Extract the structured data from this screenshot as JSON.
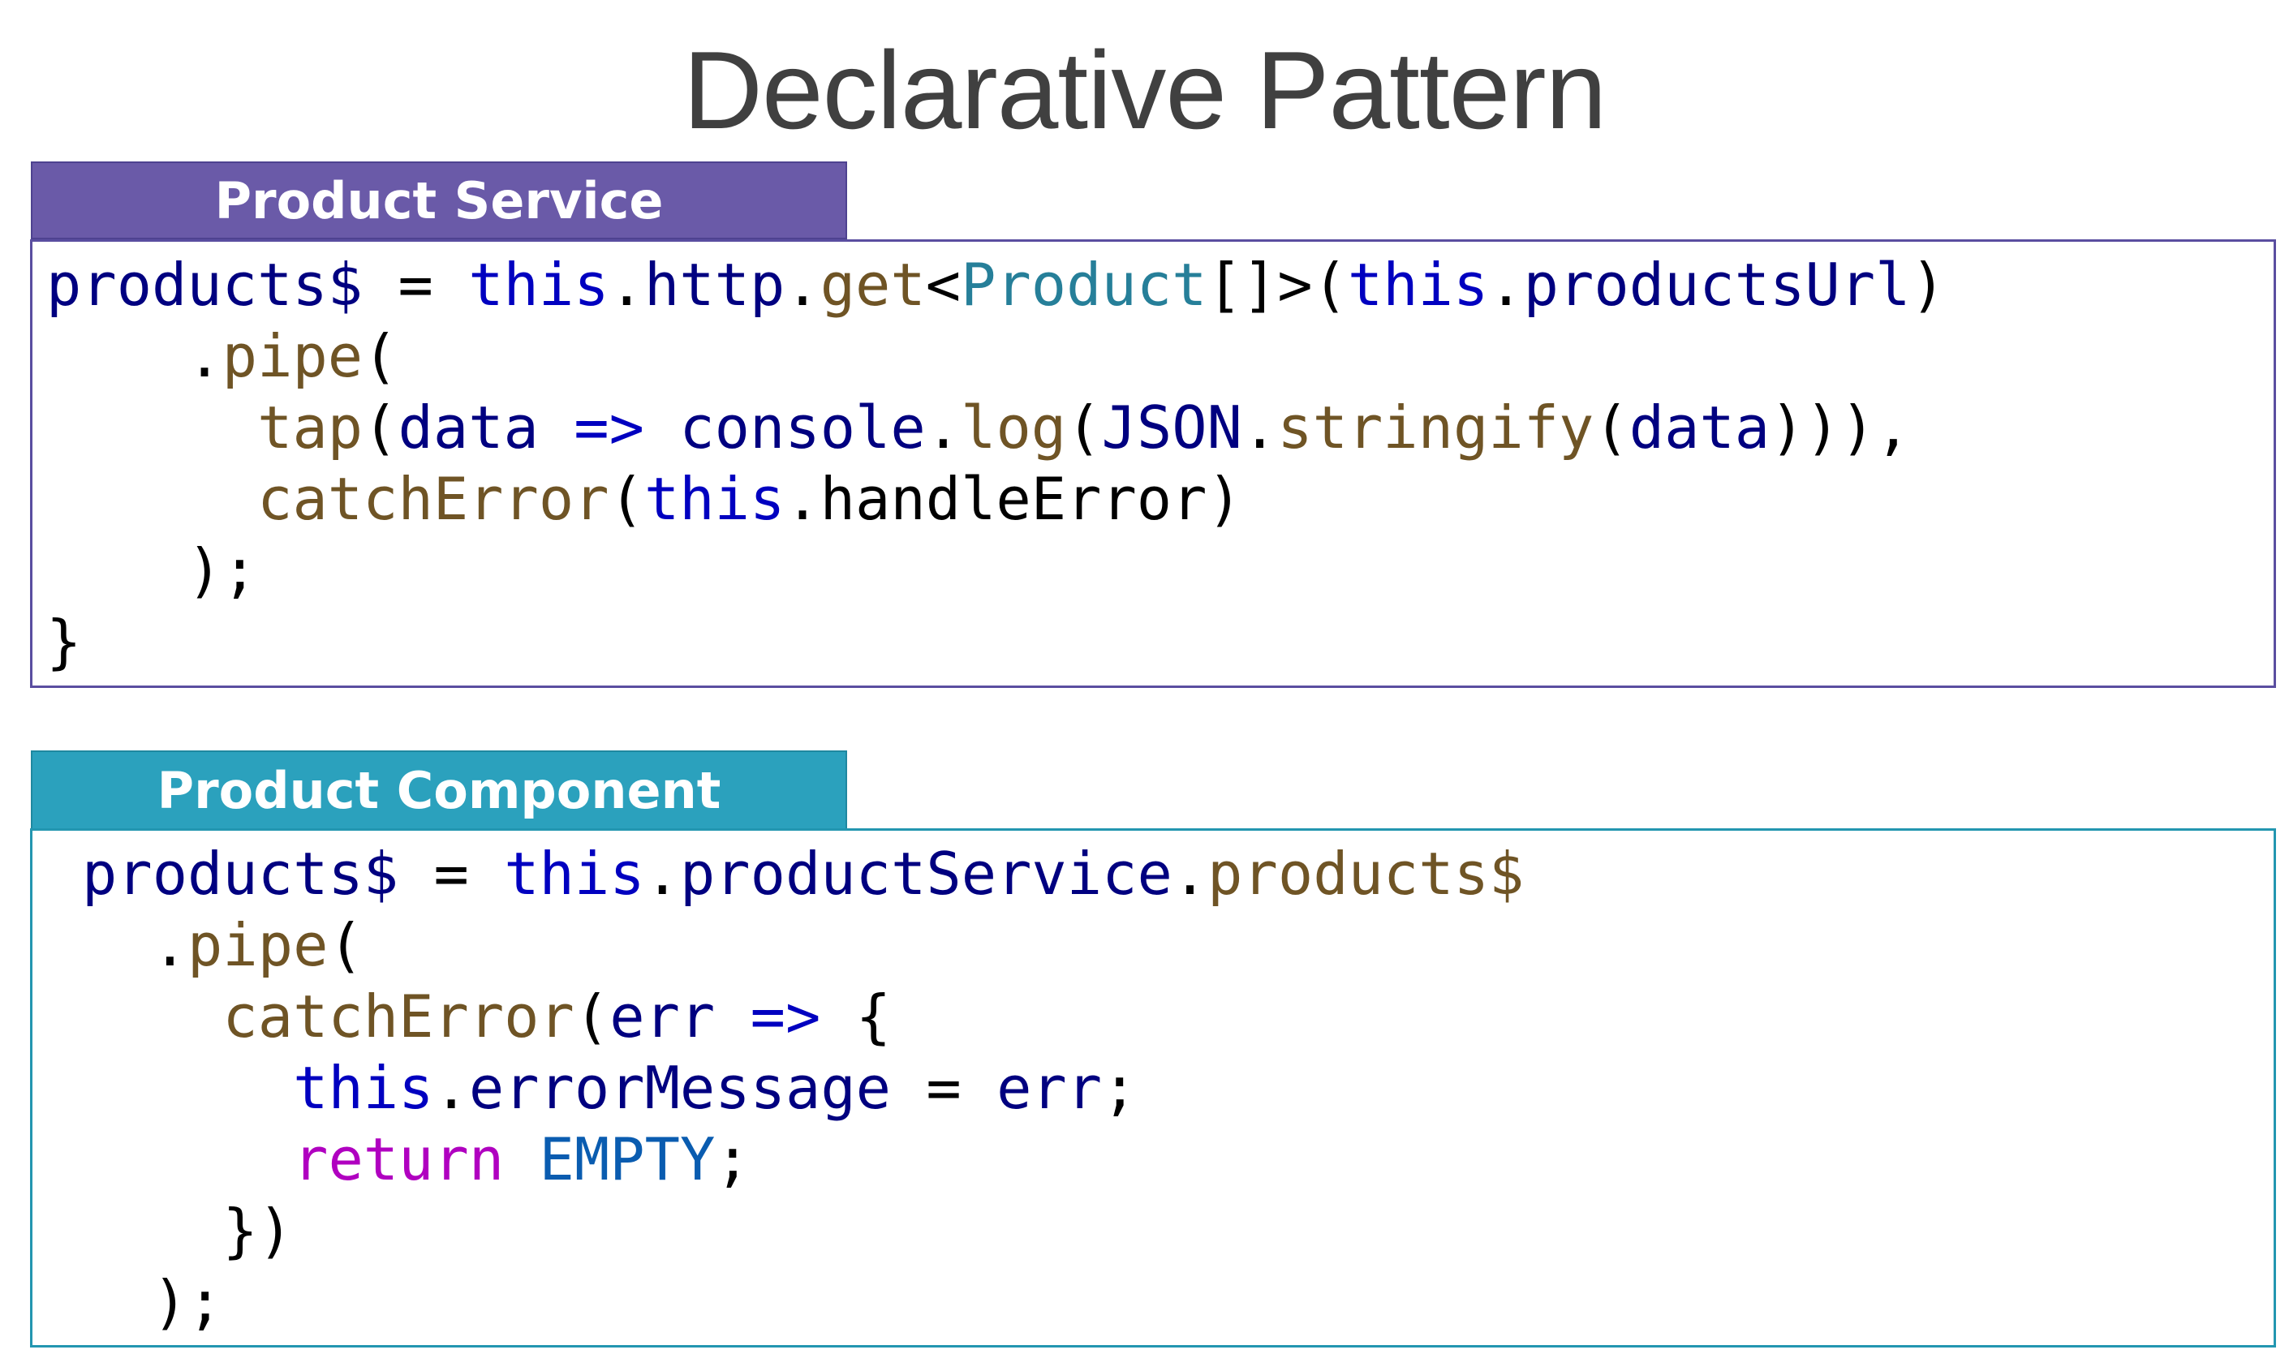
{
  "title": "Declarative Pattern",
  "service": {
    "header": "Product Service",
    "lines": [
      [
        {
          "t": "products$",
          "c": "var"
        },
        {
          "t": " = ",
          "c": "punct"
        },
        {
          "t": "this",
          "c": "kw"
        },
        {
          "t": ".",
          "c": "punct"
        },
        {
          "t": "http",
          "c": "var"
        },
        {
          "t": ".",
          "c": "punct"
        },
        {
          "t": "get",
          "c": "fn"
        },
        {
          "t": "<",
          "c": "punct"
        },
        {
          "t": "Product",
          "c": "type"
        },
        {
          "t": "[]>(",
          "c": "punct"
        },
        {
          "t": "this",
          "c": "kw"
        },
        {
          "t": ".",
          "c": "punct"
        },
        {
          "t": "productsUrl",
          "c": "var"
        },
        {
          "t": ")",
          "c": "punct"
        }
      ],
      [
        {
          "t": "    .",
          "c": "punct"
        },
        {
          "t": "pipe",
          "c": "fn"
        },
        {
          "t": "(",
          "c": "punct"
        }
      ],
      [
        {
          "t": "      ",
          "c": "punct"
        },
        {
          "t": "tap",
          "c": "fn"
        },
        {
          "t": "(",
          "c": "punct"
        },
        {
          "t": "data",
          "c": "var"
        },
        {
          "t": " ",
          "c": "punct"
        },
        {
          "t": "=>",
          "c": "kw"
        },
        {
          "t": " ",
          "c": "punct"
        },
        {
          "t": "console",
          "c": "var"
        },
        {
          "t": ".",
          "c": "punct"
        },
        {
          "t": "log",
          "c": "fn"
        },
        {
          "t": "(",
          "c": "punct"
        },
        {
          "t": "JSON",
          "c": "var"
        },
        {
          "t": ".",
          "c": "punct"
        },
        {
          "t": "stringify",
          "c": "fn"
        },
        {
          "t": "(",
          "c": "punct"
        },
        {
          "t": "data",
          "c": "var"
        },
        {
          "t": "))),",
          "c": "punct"
        }
      ],
      [
        {
          "t": "      ",
          "c": "punct"
        },
        {
          "t": "catchError",
          "c": "fn"
        },
        {
          "t": "(",
          "c": "punct"
        },
        {
          "t": "this",
          "c": "kw"
        },
        {
          "t": ".handleError)",
          "c": "punct"
        }
      ],
      [
        {
          "t": "    );",
          "c": "punct"
        }
      ],
      [
        {
          "t": "}",
          "c": "punct"
        }
      ]
    ]
  },
  "component": {
    "header": "Product Component",
    "lines": [
      [
        {
          "t": "products$",
          "c": "var"
        },
        {
          "t": " = ",
          "c": "punct"
        },
        {
          "t": "this",
          "c": "kw"
        },
        {
          "t": ".",
          "c": "punct"
        },
        {
          "t": "productService",
          "c": "var"
        },
        {
          "t": ".",
          "c": "punct"
        },
        {
          "t": "products$",
          "c": "fn"
        }
      ],
      [
        {
          "t": "  .",
          "c": "punct"
        },
        {
          "t": "pipe",
          "c": "fn"
        },
        {
          "t": "(",
          "c": "punct"
        }
      ],
      [
        {
          "t": "    ",
          "c": "punct"
        },
        {
          "t": "catchError",
          "c": "fn"
        },
        {
          "t": "(",
          "c": "punct"
        },
        {
          "t": "err",
          "c": "var"
        },
        {
          "t": " ",
          "c": "punct"
        },
        {
          "t": "=>",
          "c": "kw"
        },
        {
          "t": " {",
          "c": "punct"
        }
      ],
      [
        {
          "t": "      ",
          "c": "punct"
        },
        {
          "t": "this",
          "c": "kw"
        },
        {
          "t": ".",
          "c": "punct"
        },
        {
          "t": "errorMessage",
          "c": "var"
        },
        {
          "t": " = ",
          "c": "punct"
        },
        {
          "t": "err",
          "c": "var"
        },
        {
          "t": ";",
          "c": "punct"
        }
      ],
      [
        {
          "t": "      ",
          "c": "punct"
        },
        {
          "t": "return",
          "c": "ret"
        },
        {
          "t": " ",
          "c": "punct"
        },
        {
          "t": "EMPTY",
          "c": "const"
        },
        {
          "t": ";",
          "c": "punct"
        }
      ],
      [
        {
          "t": "    })",
          "c": "punct"
        }
      ],
      [
        {
          "t": "  );",
          "c": "punct"
        }
      ]
    ]
  },
  "colors": {
    "service_header": "#6a5aa8",
    "component_header": "#2ba1bd",
    "title_text": "#404040"
  }
}
